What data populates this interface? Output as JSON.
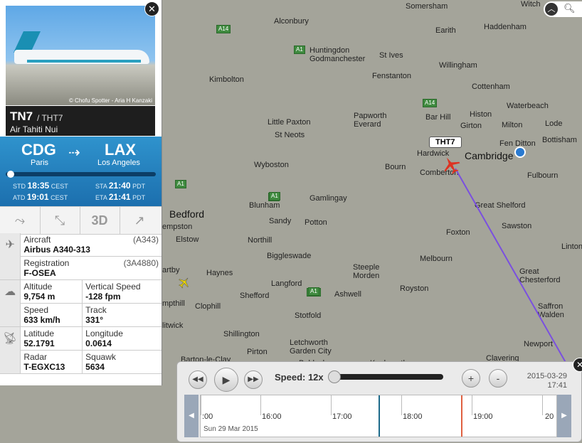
{
  "map": {
    "towns": [
      {
        "name": "Somersham"
      },
      {
        "name": "Witch"
      },
      {
        "name": "Alconbury"
      },
      {
        "name": "Earith"
      },
      {
        "name": "Haddenham"
      },
      {
        "name": "Huntingdon\nGodmanchester"
      },
      {
        "name": "St Ives"
      },
      {
        "name": "Willingham"
      },
      {
        "name": "Kimbolton"
      },
      {
        "name": "Fenstanton"
      },
      {
        "name": "Cottenham"
      },
      {
        "name": "Waterbeach"
      },
      {
        "name": "Bar Hill"
      },
      {
        "name": "Histon"
      },
      {
        "name": "Papworth\nEverard"
      },
      {
        "name": "Little Paxton"
      },
      {
        "name": "Girton"
      },
      {
        "name": "Milton"
      },
      {
        "name": "Lode"
      },
      {
        "name": "St Neots"
      },
      {
        "name": "Fen Ditton"
      },
      {
        "name": "Bottisham"
      },
      {
        "name": "Hardwick"
      },
      {
        "name": "Wyboston"
      },
      {
        "name": "Cambridge"
      },
      {
        "name": "Bourn"
      },
      {
        "name": "Comberton"
      },
      {
        "name": "Fulbourn"
      },
      {
        "name": "Gamlingay"
      },
      {
        "name": "Bedford"
      },
      {
        "name": "Blunham"
      },
      {
        "name": "Great Shelford"
      },
      {
        "name": "Elstow"
      },
      {
        "name": "Sandy"
      },
      {
        "name": "Potton"
      },
      {
        "name": "Foxton"
      },
      {
        "name": "Sawston"
      },
      {
        "name": "Northill"
      },
      {
        "name": "Linton"
      },
      {
        "name": "Biggleswade"
      },
      {
        "name": "Melbourn"
      },
      {
        "name": "Haynes"
      },
      {
        "name": "Steeple\nMorden"
      },
      {
        "name": "Great\nChesterford"
      },
      {
        "name": "Langford"
      },
      {
        "name": "Royston"
      },
      {
        "name": "Clophill"
      },
      {
        "name": "Shefford"
      },
      {
        "name": "Ashwell"
      },
      {
        "name": "Saffron\nWalden"
      },
      {
        "name": "Stotfold"
      },
      {
        "name": "Shillington"
      },
      {
        "name": "Letchworth\nGarden City"
      },
      {
        "name": "Newport"
      },
      {
        "name": "Pirton"
      },
      {
        "name": "Barton-le-Clay"
      },
      {
        "name": "Clavering"
      },
      {
        "name": "Baldock"
      },
      {
        "name": "empston"
      },
      {
        "name": "artby"
      },
      {
        "name": "mpthill"
      },
      {
        "name": "litwick"
      },
      {
        "name": "Knebworth"
      }
    ],
    "roads": [
      "A14",
      "A1",
      "A14",
      "A1",
      "A14",
      "A1",
      "A1",
      "A1",
      "A1",
      "A1"
    ],
    "callsign_label": "THT7"
  },
  "flight": {
    "photo_credit": "© Chofu Spotter - Aria H Kanzaki",
    "flight_number": "TN7",
    "callsign": "/ THT7",
    "airline": "Air Tahiti Nui",
    "origin_code": "CDG",
    "origin_city": "Paris",
    "dest_code": "LAX",
    "dest_city": "Los Angeles",
    "progress": 0.02,
    "std_label": "STD",
    "std_time": "18:35",
    "std_tz": "CEST",
    "atd_label": "ATD",
    "atd_time": "19:01",
    "atd_tz": "CEST",
    "sta_label": "STA",
    "sta_time": "21:40",
    "sta_tz": "PDT",
    "eta_label": "ETA",
    "eta_time": "21:41",
    "eta_tz": "PDT",
    "tool_3d": "3D"
  },
  "details": {
    "aircraft_label": "Aircraft",
    "aircraft_code": "(A343)",
    "aircraft_value": "Airbus A340-313",
    "registration_label": "Registration",
    "registration_code": "(3A4880)",
    "registration_value": "F-OSEA",
    "altitude_label": "Altitude",
    "altitude_value": "9,754 m",
    "vspeed_label": "Vertical Speed",
    "vspeed_value": "-128 fpm",
    "speed_label": "Speed",
    "speed_value": "633 km/h",
    "track_label": "Track",
    "track_value": "331°",
    "lat_label": "Latitude",
    "lat_value": "52.1791",
    "lon_label": "Longitude",
    "lon_value": "0.0614",
    "radar_label": "Radar",
    "radar_value": "T-EGXC13",
    "squawk_label": "Squawk",
    "squawk_value": "5634"
  },
  "playback": {
    "speed_label": "Speed: 12x",
    "date": "2015-03-29",
    "time": "17:41",
    "timeline_labels": [
      ":00",
      "16:00",
      "17:00",
      "18:00",
      "19:00",
      "20"
    ],
    "timeline_date": "Sun 29 Mar 2015",
    "colors": {
      "playhead": "#1c6a8a",
      "marker": "#e06040"
    }
  },
  "colors": {
    "track_line": "#7a4fe0",
    "route_bg": "#2f93cd"
  }
}
